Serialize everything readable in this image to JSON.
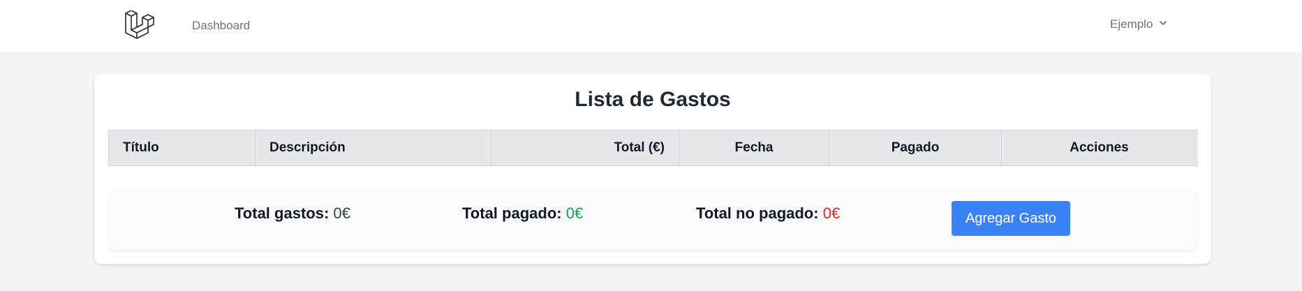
{
  "nav": {
    "logo_icon": "laravel-logo-icon",
    "dashboard_label": "Dashboard",
    "user_label": "Ejemplo",
    "user_menu_icon": "chevron-down-icon"
  },
  "card": {
    "title": "Lista de Gastos"
  },
  "table": {
    "headers": [
      "Título",
      "Descripción",
      "Total (€)",
      "Fecha",
      "Pagado",
      "Acciones"
    ],
    "rows": []
  },
  "summary": {
    "total_gastos_label": "Total gastos:",
    "total_gastos_value": "0€",
    "total_pagado_label": "Total pagado:",
    "total_pagado_value": "0€",
    "total_no_pagado_label": "Total no pagado:",
    "total_no_pagado_value": "0€",
    "add_button_label": "Agregar Gasto"
  },
  "colors": {
    "pagado": "#16a34a",
    "no_pagado": "#dc2626",
    "neutral": "#374151",
    "button": "#3b82f6"
  }
}
